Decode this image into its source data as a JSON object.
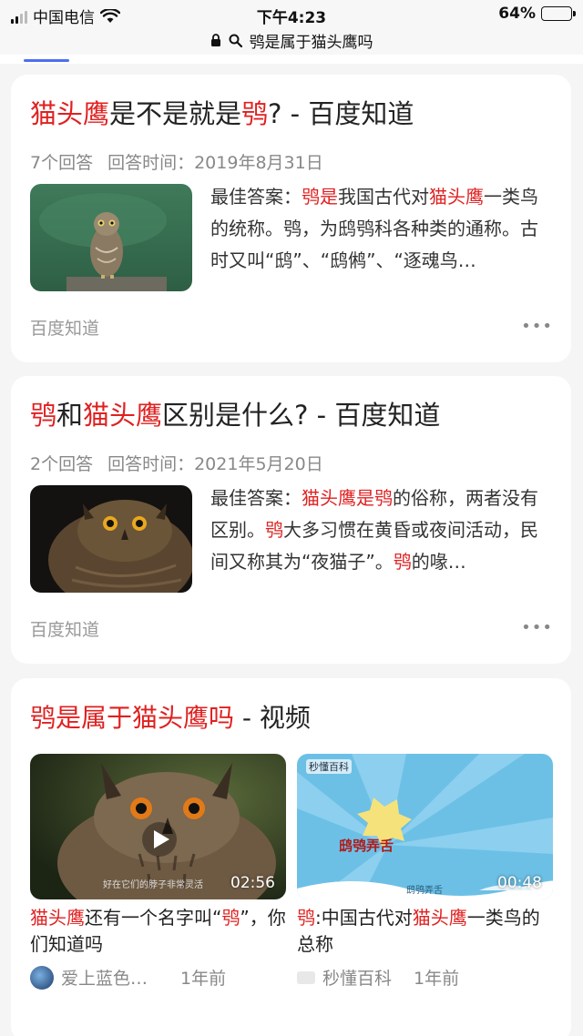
{
  "status": {
    "carrier": "中国电信",
    "time": "下午4:23",
    "battery_percent": "64%",
    "battery_level": 0.64
  },
  "url": {
    "title": "鸮是属于猫头鹰吗"
  },
  "results": [
    {
      "title_parts": [
        "猫头鹰",
        "是不是就是",
        "鸮",
        "? - 百度知道"
      ],
      "answer_count": "7个回答",
      "answer_time": "回答时间：2019年8月31日",
      "answer_parts": [
        "最佳答案：",
        "鸮是",
        "我国古代对",
        "猫头鹰",
        "一类鸟的统称。鸮，为鸱鸮科各种类的通称。古时又叫“鸱”、“鸱鸺”、“逐魂鸟…"
      ],
      "source": "百度知道",
      "more": "•••"
    },
    {
      "title_parts": [
        "鸮",
        "和",
        "猫头鹰",
        "区别是什么? - 百度知道"
      ],
      "answer_count": "2个回答",
      "answer_time": "回答时间：2021年5月20日",
      "answer_parts": [
        "最佳答案：",
        "猫头鹰是鸮",
        "的俗称，两者没有区别。",
        "鸮",
        "大多习惯在黄昏或夜间活动，民间又称其为“夜猫子”。",
        "鸮",
        "的喙…"
      ],
      "source": "百度知道",
      "more": "•••"
    }
  ],
  "video_section": {
    "title_red": "鸮是属于猫头鹰吗",
    "title_suffix": " - 视频",
    "videos": [
      {
        "duration": "02:56",
        "overlay_text": "好在它们的脖子非常灵活",
        "caption_parts": [
          "猫头鹰",
          "还有一个名字叫“",
          "鸮",
          "”，你们知道吗"
        ],
        "author": "爱上蓝色…",
        "ago": "1年前"
      },
      {
        "duration": "00:48",
        "badge": "秒懂百科",
        "overlay_text": "鸱鸮弄舌",
        "bottom_text": "鸱鸮弄舌",
        "caption_parts": [
          "鸮",
          ":中国古代对",
          "猫头鹰",
          "一类鸟的总称"
        ],
        "author": "秒懂百科",
        "ago": "1年前"
      }
    ]
  }
}
